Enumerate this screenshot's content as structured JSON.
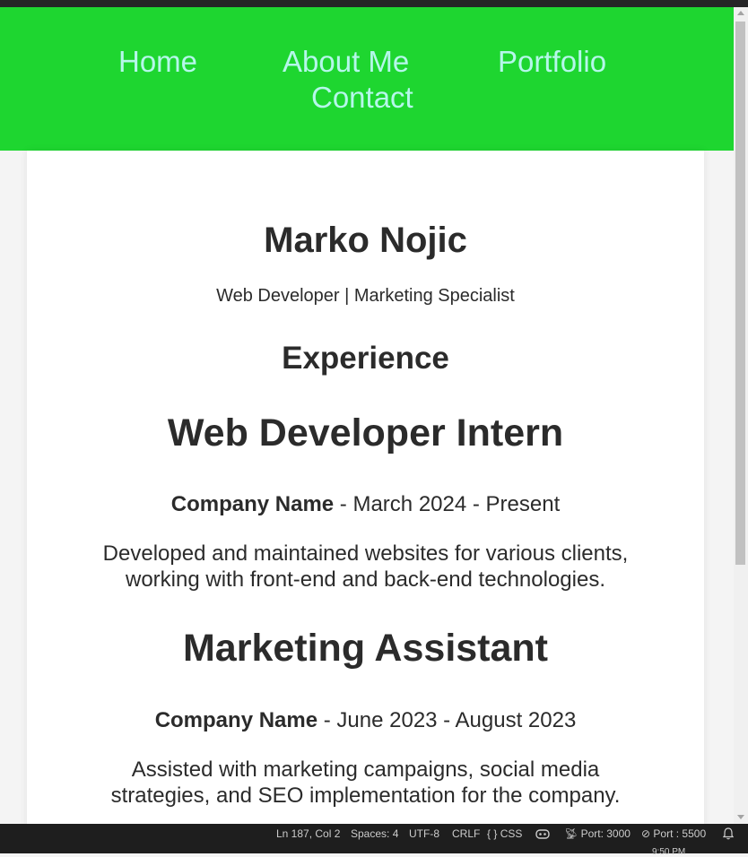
{
  "nav": {
    "home": "Home",
    "about": "About Me",
    "portfolio": "Portfolio",
    "contact": "Contact"
  },
  "profile": {
    "name": "Marko Nojic",
    "tagline": "Web Developer | Marketing Specialist"
  },
  "experience": {
    "heading": "Experience",
    "jobs": [
      {
        "title": "Web Developer Intern",
        "company": "Company Name",
        "period": " - March 2024 - Present",
        "description": "Developed and maintained websites for various clients, working with front-end and back-end technologies."
      },
      {
        "title": "Marketing Assistant",
        "company": "Company Name",
        "period": " - June 2023 - August 2023",
        "description": "Assisted with marketing campaigns, social media strategies, and SEO implementation for the company."
      }
    ]
  },
  "statusbar": {
    "position": "Ln 187, Col 2",
    "spaces": "Spaces: 4",
    "encoding": "UTF-8",
    "eol": "CRLF",
    "language": "CSS",
    "port_server": "Port: 3000",
    "port_live": "Port : 5500",
    "time": "9:50 PM"
  },
  "colors": {
    "navbar": "#1ed630",
    "nav_link": "#b5f7ea",
    "text": "#2b2b2b",
    "statusbar": "#1e1e1e"
  }
}
